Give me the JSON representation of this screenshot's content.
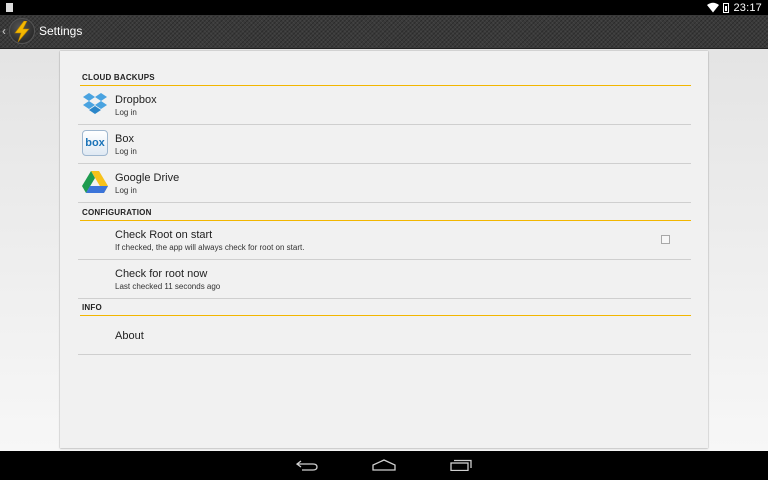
{
  "status_bar": {
    "time": "23:17"
  },
  "action_bar": {
    "back_glyph": "‹",
    "title": "Settings",
    "icon": "lightning-bolt-logo"
  },
  "sections": {
    "cloud": {
      "header": "CLOUD BACKUPS",
      "items": [
        {
          "title": "Dropbox",
          "subtitle": "Log in",
          "icon": "dropbox-icon"
        },
        {
          "title": "Box",
          "subtitle": "Log in",
          "icon": "box-icon",
          "icon_text": "box"
        },
        {
          "title": "Google Drive",
          "subtitle": "Log in",
          "icon": "google-drive-icon"
        }
      ]
    },
    "config": {
      "header": "CONFIGURATION",
      "items": [
        {
          "title": "Check Root on start",
          "subtitle": "If checked, the app will always check for root on start.",
          "checked": false
        },
        {
          "title": "Check for root now",
          "subtitle": "Last checked 11 seconds ago"
        }
      ]
    },
    "info": {
      "header": "INFO",
      "items": [
        {
          "title": "About"
        }
      ]
    }
  },
  "colors": {
    "accent": "#f2b600",
    "statusbar": "#000000",
    "card": "#f1f1f1"
  },
  "nav_bar": {
    "icons": [
      "back-icon",
      "home-icon",
      "recents-icon"
    ]
  }
}
